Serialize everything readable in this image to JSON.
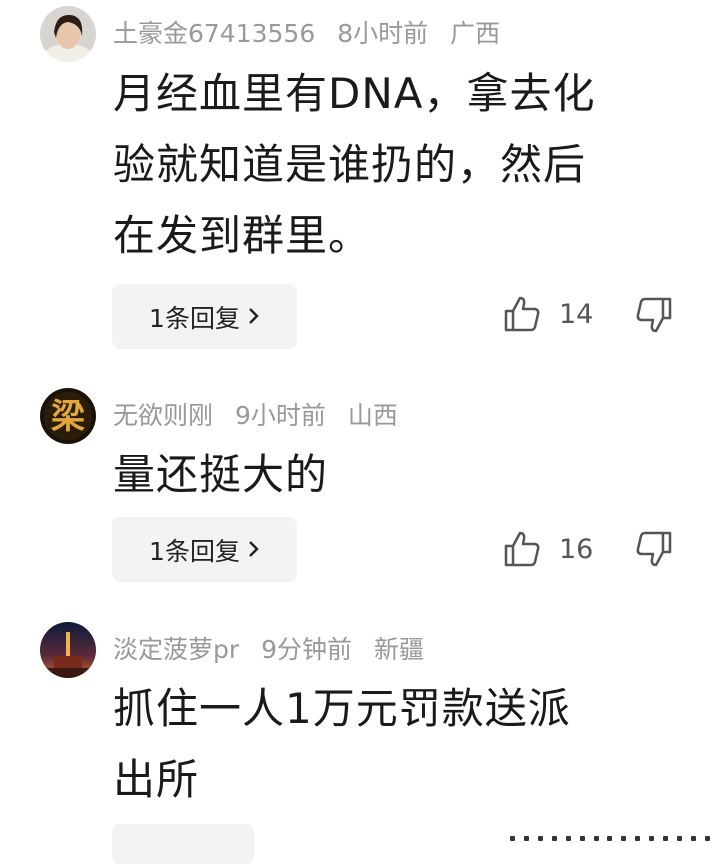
{
  "comments": [
    {
      "username": "土豪金67413556",
      "time": "8小时前",
      "location": "广西",
      "text": "月经血里有DNA，拿去化\n验就知道是谁扔的，然后\n在发到群里。",
      "reply_label": "1条回复",
      "likes": "14",
      "avatar_char": ""
    },
    {
      "username": "无欲则刚",
      "time": "9小时前",
      "location": "山西",
      "text": "量还挺大的",
      "reply_label": "1条回复",
      "likes": "16",
      "avatar_char": "梁"
    },
    {
      "username": "淡定菠萝pr",
      "time": "9分钟前",
      "location": "新疆",
      "text": "抓住一人1万元罚款送派\n出所",
      "reply_label": "",
      "likes": "",
      "avatar_char": ""
    }
  ],
  "colors": {
    "meta": "#999999",
    "text": "#1a1a1a",
    "button_bg": "#f3f3f3",
    "icon": "#555555"
  },
  "icons": {
    "like": "thumbs-up-icon",
    "dislike": "thumbs-down-icon",
    "chevron": "chevron-right-icon"
  }
}
